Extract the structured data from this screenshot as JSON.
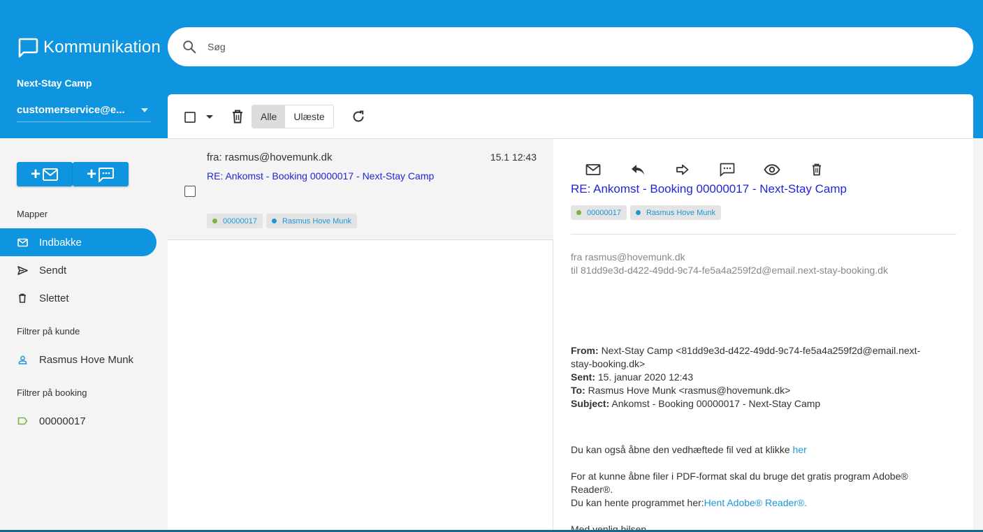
{
  "app": {
    "title": "Kommunikation",
    "company": "Next-Stay Camp",
    "account": "customerservice@e...",
    "accent": "#0f95df"
  },
  "search": {
    "placeholder": "Søg"
  },
  "sidebar": {
    "new_mail_label": "+",
    "new_sms_label": "+",
    "folders_title": "Mapper",
    "folders": [
      {
        "label": "Indbakke",
        "icon": "mail-icon",
        "active": true
      },
      {
        "label": "Sendt",
        "icon": "send-icon",
        "active": false
      },
      {
        "label": "Slettet",
        "icon": "trash-icon",
        "active": false
      }
    ],
    "customer_filter_title": "Filtrer på kunde",
    "customer_filter": {
      "label": "Rasmus Hove Munk",
      "icon": "person-icon"
    },
    "booking_filter_title": "Filtrer på booking",
    "booking_filter": {
      "label": "00000017",
      "icon": "label-icon"
    }
  },
  "toolbar": {
    "filter_all": "Alle",
    "filter_unread": "Ulæste",
    "active_filter": "Alle"
  },
  "list": {
    "items": [
      {
        "from": "fra: rasmus@hovemunk.dk",
        "date": "15.1 12:43",
        "subject": "RE: Ankomst - Booking 00000017 - Next-Stay Camp",
        "tags": [
          {
            "label": "00000017",
            "color": "#7cb342"
          },
          {
            "label": "Rasmus Hove Munk",
            "color": "#1b96d8"
          }
        ]
      }
    ]
  },
  "detail": {
    "title": "RE: Ankomst - Booking 00000017 - Next-Stay Camp",
    "tags": [
      {
        "label": "00000017",
        "color": "#7cb342"
      },
      {
        "label": "Rasmus Hove Munk",
        "color": "#1b96d8"
      }
    ],
    "from_line": "fra rasmus@hovemunk.dk",
    "to_line": "til 81dd9e3d-d422-49dd-9c74-fe5a4a259f2d@email.next-stay-booking.dk",
    "quoted": {
      "from_label": "From:",
      "from_value": "Next-Stay Camp <81dd9e3d-d422-49dd-9c74-fe5a4a259f2d@email.next-",
      "from_value_cont": "stay-booking.dk>",
      "sent_label": "Sent:",
      "sent_value": "15. januar 2020 12:43",
      "to_label": "To:",
      "to_value": "Rasmus Hove Munk <rasmus@hovemunk.dk>",
      "subject_label": "Subject:",
      "subject_value": "Ankomst - Booking 00000017 - Next-Stay Camp"
    },
    "body": {
      "p1": "Du kan også åbne den vedhæftede fil ved at klikke ",
      "p1_link": "her",
      "p2a": "For at kunne åbne filer i PDF-format skal du bruge det gratis program Adobe®",
      "p2b": "Reader®.",
      "p2c": "Du kan hente programmet her:",
      "p2c_link": "Hent Adobe® Reader®.",
      "p3": "Med venlig hilsen"
    }
  }
}
